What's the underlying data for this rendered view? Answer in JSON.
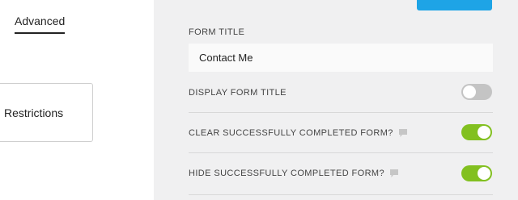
{
  "sidebar": {
    "active_tab": "Advanced",
    "restrictions_label": "Restrictions"
  },
  "form": {
    "title_label": "FORM TITLE",
    "title_value": "Contact Me",
    "settings": [
      {
        "label": "DISPLAY FORM TITLE",
        "enabled": false,
        "has_help": false
      },
      {
        "label": "CLEAR SUCCESSFULLY COMPLETED FORM?",
        "enabled": true,
        "has_help": true
      },
      {
        "label": "HIDE SUCCESSFULLY COMPLETED FORM?",
        "enabled": true,
        "has_help": true
      }
    ]
  },
  "colors": {
    "accent_blue": "#1ea4e6",
    "toggle_on": "#82c020",
    "toggle_off": "#c4c4c4",
    "panel_bg": "#f0f0f1"
  },
  "icons": {
    "help": "speech-bubble-icon"
  }
}
